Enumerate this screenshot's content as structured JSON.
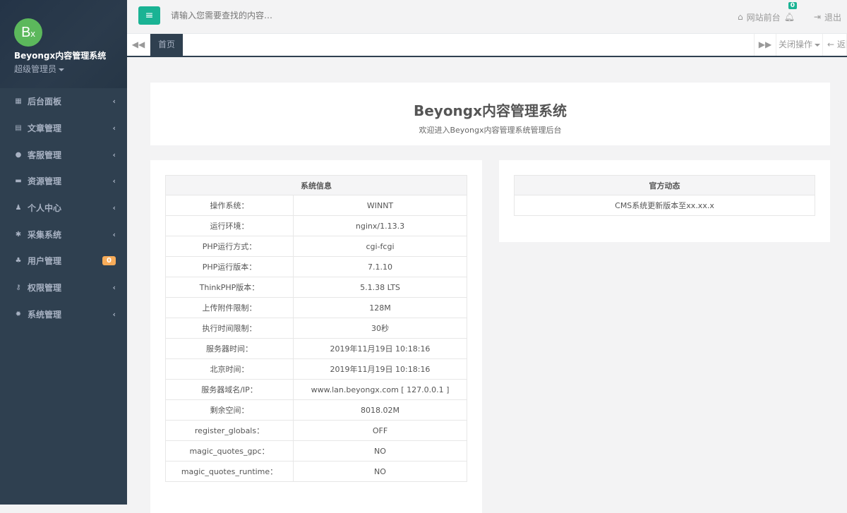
{
  "brand": {
    "logo": "Bx",
    "name": "Beyongx内容管理系统",
    "role": "超级管理员"
  },
  "sidebar": {
    "items": [
      {
        "label": "后台面板",
        "icon": "dashboard-icon",
        "glyph": "▦"
      },
      {
        "label": "文章管理",
        "icon": "file-icon",
        "glyph": "▤"
      },
      {
        "label": "客服管理",
        "icon": "comment-icon",
        "glyph": "●"
      },
      {
        "label": "资源管理",
        "icon": "archive-icon",
        "glyph": "▬"
      },
      {
        "label": "个人中心",
        "icon": "user-icon",
        "glyph": "♟"
      },
      {
        "label": "采集系统",
        "icon": "bug-icon",
        "glyph": "✱"
      },
      {
        "label": "用户管理",
        "icon": "users-icon",
        "glyph": "♣",
        "badge": "0"
      },
      {
        "label": "权限管理",
        "icon": "key-icon",
        "glyph": "⚷"
      },
      {
        "label": "系统管理",
        "icon": "gear-icon",
        "glyph": "✹"
      }
    ]
  },
  "topbar": {
    "search_placeholder": "请输入您需要查找的内容…",
    "site_front": "网站前台",
    "notifications": "0",
    "logout": "退出"
  },
  "tabs": {
    "home": "首页",
    "close_ops": "关闭操作",
    "back": "← 返回"
  },
  "hero": {
    "title": "Beyongx内容管理系统",
    "subtitle": "欢迎进入Beyongx内容管理系统管理后台"
  },
  "sysinfo": {
    "title": "系统信息",
    "rows": [
      [
        "操作系统：",
        "WINNT"
      ],
      [
        "运行环境：",
        "nginx/1.13.3"
      ],
      [
        "PHP运行方式：",
        "cgi-fcgi"
      ],
      [
        "PHP运行版本：",
        "7.1.10"
      ],
      [
        "ThinkPHP版本：",
        "5.1.38 LTS"
      ],
      [
        "上传附件限制：",
        "128M"
      ],
      [
        "执行时间限制：",
        "30秒"
      ],
      [
        "服务器时间：",
        "2019年11月19日 10:18:16"
      ],
      [
        "北京时间：",
        "2019年11月19日 10:18:16"
      ],
      [
        "服务器域名/IP：",
        "www.lan.beyongx.com [ 127.0.0.1 ]"
      ],
      [
        "剩余空间：",
        "8018.02M"
      ],
      [
        "register_globals：",
        "OFF"
      ],
      [
        "magic_quotes_gpc：",
        "NO"
      ],
      [
        "magic_quotes_runtime：",
        "NO"
      ]
    ]
  },
  "news": {
    "title": "官方动态",
    "items": [
      "CMS系统更新版本至xx.xx.x"
    ]
  }
}
